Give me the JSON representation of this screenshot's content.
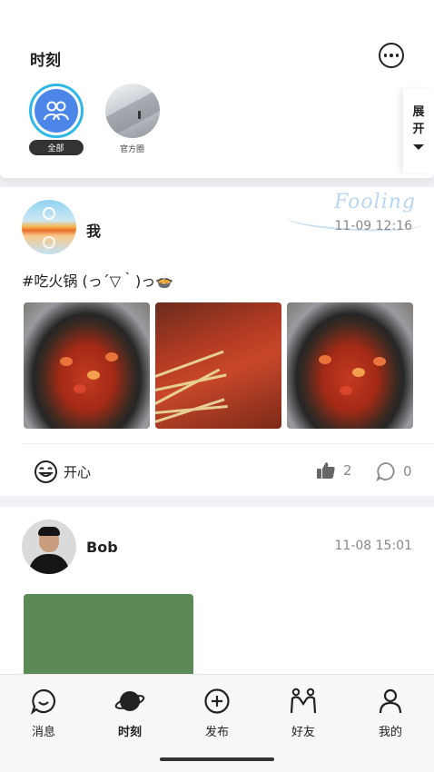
{
  "header": {
    "title": "时刻",
    "circles": [
      {
        "label": "全部"
      },
      {
        "label": "官方圈"
      }
    ],
    "expand": [
      "展",
      "开"
    ]
  },
  "posts": [
    {
      "username": "我",
      "time": "11-09 12:16",
      "watermark": "Fooling",
      "text": "#吃火锅 (っ´▽｀)っ🍲",
      "mood": "开心",
      "likes": "2",
      "comments": "0"
    },
    {
      "username": "Bob",
      "time": "11-08 15:01"
    }
  ],
  "nav": [
    {
      "label": "消息",
      "icon": "message-icon"
    },
    {
      "label": "时刻",
      "icon": "planet-icon",
      "active": true
    },
    {
      "label": "发布",
      "icon": "add-circle-icon"
    },
    {
      "label": "好友",
      "icon": "friends-icon"
    },
    {
      "label": "我的",
      "icon": "person-icon"
    }
  ]
}
